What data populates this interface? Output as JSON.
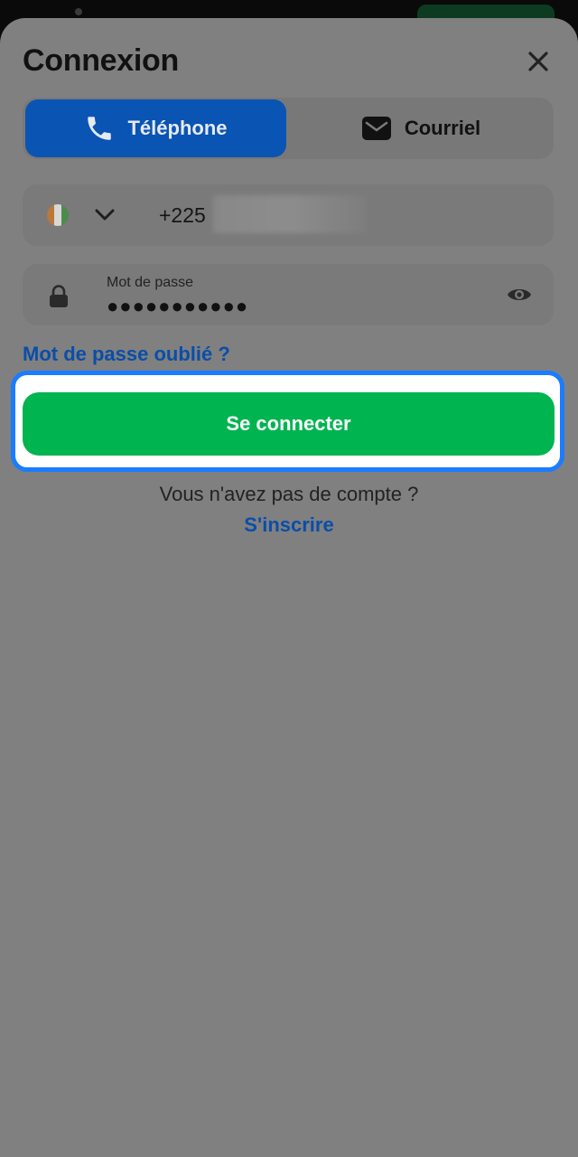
{
  "dialog": {
    "title": "Connexion"
  },
  "tabs": [
    {
      "label": "Téléphone",
      "icon": "phone-icon",
      "selected": true
    },
    {
      "label": "Courriel",
      "icon": "mail-icon",
      "selected": false
    }
  ],
  "phone": {
    "country_flag": "cote-divoire-flag-icon",
    "dial_code": "+225"
  },
  "password": {
    "label": "Mot de passe",
    "value": "●●●●●●●●●●●"
  },
  "links": {
    "forgot_password": "Mot de passe oublié ?",
    "signup": "S'inscrire"
  },
  "login_button": {
    "label": "Se connecter"
  },
  "footer": {
    "no_account": "Vous n'avez pas de compte ?"
  },
  "colors": {
    "selected_tab": "#0a54b3",
    "primary_button": "#00b450",
    "link": "#0a4ea8",
    "highlight_border": "#1a7cff",
    "overlay_sheet": "#808080"
  }
}
